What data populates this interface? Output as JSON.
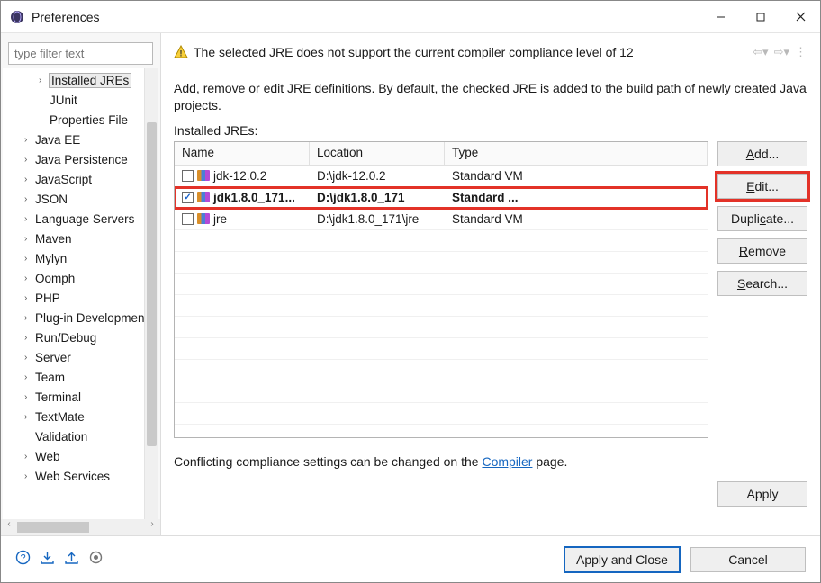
{
  "window": {
    "title": "Preferences"
  },
  "filter": {
    "placeholder": "type filter text"
  },
  "tree": [
    {
      "label": "Installed JREs",
      "depth": 2,
      "arrow": "›",
      "selected": true
    },
    {
      "label": "JUnit",
      "depth": 2,
      "arrow": ""
    },
    {
      "label": "Properties File",
      "depth": 2,
      "arrow": ""
    },
    {
      "label": "Java EE",
      "depth": 1,
      "arrow": "›"
    },
    {
      "label": "Java Persistence",
      "depth": 1,
      "arrow": "›"
    },
    {
      "label": "JavaScript",
      "depth": 1,
      "arrow": "›"
    },
    {
      "label": "JSON",
      "depth": 1,
      "arrow": "›"
    },
    {
      "label": "Language Servers",
      "depth": 1,
      "arrow": "›"
    },
    {
      "label": "Maven",
      "depth": 1,
      "arrow": "›"
    },
    {
      "label": "Mylyn",
      "depth": 1,
      "arrow": "›"
    },
    {
      "label": "Oomph",
      "depth": 1,
      "arrow": "›"
    },
    {
      "label": "PHP",
      "depth": 1,
      "arrow": "›"
    },
    {
      "label": "Plug-in Development",
      "depth": 1,
      "arrow": "›"
    },
    {
      "label": "Run/Debug",
      "depth": 1,
      "arrow": "›"
    },
    {
      "label": "Server",
      "depth": 1,
      "arrow": "›"
    },
    {
      "label": "Team",
      "depth": 1,
      "arrow": "›"
    },
    {
      "label": "Terminal",
      "depth": 1,
      "arrow": "›"
    },
    {
      "label": "TextMate",
      "depth": 1,
      "arrow": "›"
    },
    {
      "label": "Validation",
      "depth": 1,
      "arrow": ""
    },
    {
      "label": "Web",
      "depth": 1,
      "arrow": "›"
    },
    {
      "label": "Web Services",
      "depth": 1,
      "arrow": "›"
    }
  ],
  "main": {
    "warning": "The selected JRE does not support the current compiler compliance level of 12",
    "description": "Add, remove or edit JRE definitions. By default, the checked JRE is added to the build path of newly created Java projects.",
    "tableLabel": "Installed JREs:",
    "columns": {
      "name": "Name",
      "location": "Location",
      "type": "Type"
    },
    "rows": [
      {
        "checked": false,
        "name": "jdk-12.0.2",
        "location": "D:\\jdk-12.0.2",
        "type": "Standard VM",
        "selected": false
      },
      {
        "checked": true,
        "name": "jdk1.8.0_171...",
        "location": "D:\\jdk1.8.0_171",
        "type": "Standard ...",
        "selected": true
      },
      {
        "checked": false,
        "name": "jre",
        "location": "D:\\jdk1.8.0_171\\jre",
        "type": "Standard VM",
        "selected": false
      }
    ],
    "buttons": {
      "add": "Add...",
      "edit": "Edit...",
      "duplicate": "Duplicate...",
      "remove": "Remove",
      "search": "Search..."
    },
    "hint_prefix": "Conflicting compliance settings can be changed on the ",
    "hint_link": "Compiler",
    "hint_suffix": " page.",
    "apply": "Apply"
  },
  "bottom": {
    "applyClose": "Apply and Close",
    "cancel": "Cancel"
  }
}
